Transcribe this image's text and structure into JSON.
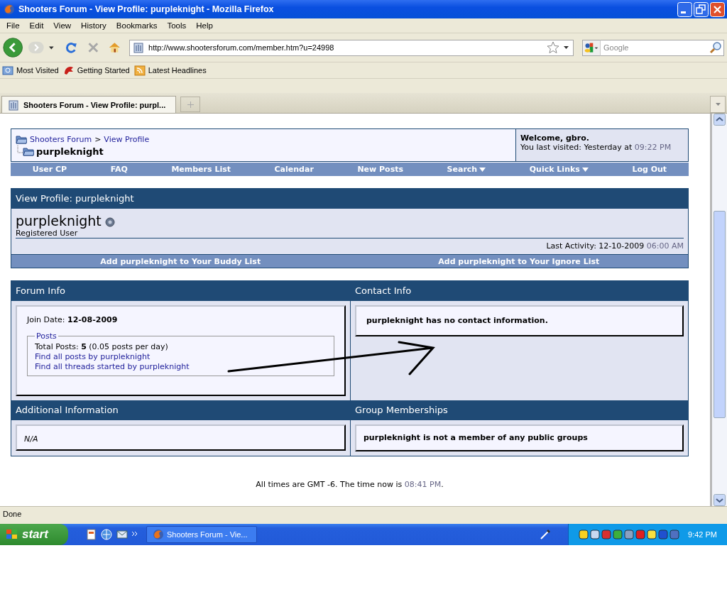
{
  "window": {
    "title": "Shooters Forum - View Profile: purpleknight - Mozilla Firefox"
  },
  "menu": [
    "File",
    "Edit",
    "View",
    "History",
    "Bookmarks",
    "Tools",
    "Help"
  ],
  "toolbar": {
    "url": "http://www.shootersforum.com/member.htm?u=24998",
    "search_placeholder": "Google"
  },
  "bookmarks": [
    "Most Visited",
    "Getting Started",
    "Latest Headlines"
  ],
  "tabs": [
    {
      "label": "Shooters Forum - View Profile: purpl...",
      "selected": true
    }
  ],
  "page": {
    "breadcrumb": {
      "links": [
        "Shooters Forum",
        "View Profile"
      ],
      "separator": ">",
      "current": "purpleknight"
    },
    "welcome": {
      "greeting": "Welcome, gbro.",
      "last_visited": "You last visited: Yesterday at",
      "time": "09:22 PM"
    },
    "navbar": [
      {
        "label": "User CP",
        "dropdown": false
      },
      {
        "label": "FAQ",
        "dropdown": false
      },
      {
        "label": "Members List",
        "dropdown": false
      },
      {
        "label": "Calendar",
        "dropdown": false
      },
      {
        "label": "New Posts",
        "dropdown": false
      },
      {
        "label": "Search",
        "dropdown": true
      },
      {
        "label": "Quick Links",
        "dropdown": true
      },
      {
        "label": "Log Out",
        "dropdown": false
      }
    ],
    "profile": {
      "header": "View Profile: purpleknight",
      "username": "purpleknight",
      "online": false,
      "rank": "Registered User",
      "last_activity_label": "Last Activity:",
      "last_activity_date": "12-10-2009",
      "last_activity_time": "06:00 AM"
    },
    "actions": [
      "Add purpleknight to Your Buddy List",
      "Add purpleknight to Your Ignore List"
    ],
    "forum_info": {
      "title": "Forum Info",
      "join_label": "Join Date:",
      "join_date": "12-08-2009",
      "posts_legend": "Posts",
      "total_posts": "Total Posts: **5** (0.05 posts per day)",
      "links": [
        "Find all posts by purpleknight",
        "Find all threads started by purpleknight"
      ]
    },
    "contact_info": {
      "title": "Contact Info",
      "message": "purpleknight has no contact information."
    },
    "additional_info": {
      "title": "Additional Information",
      "text": "N/A"
    },
    "group_memberships": {
      "title": "Group Memberships",
      "message": "purpleknight is not a member of any public groups"
    },
    "footer": {
      "text": "All times are GMT -6. The time now is",
      "time": "08:41 PM",
      "end": "."
    }
  },
  "status_bar": {
    "text": "Done"
  },
  "taskbar": {
    "start": "start",
    "tasks": [
      "Shooters Forum - Vie..."
    ],
    "clock": "9:42 PM"
  }
}
